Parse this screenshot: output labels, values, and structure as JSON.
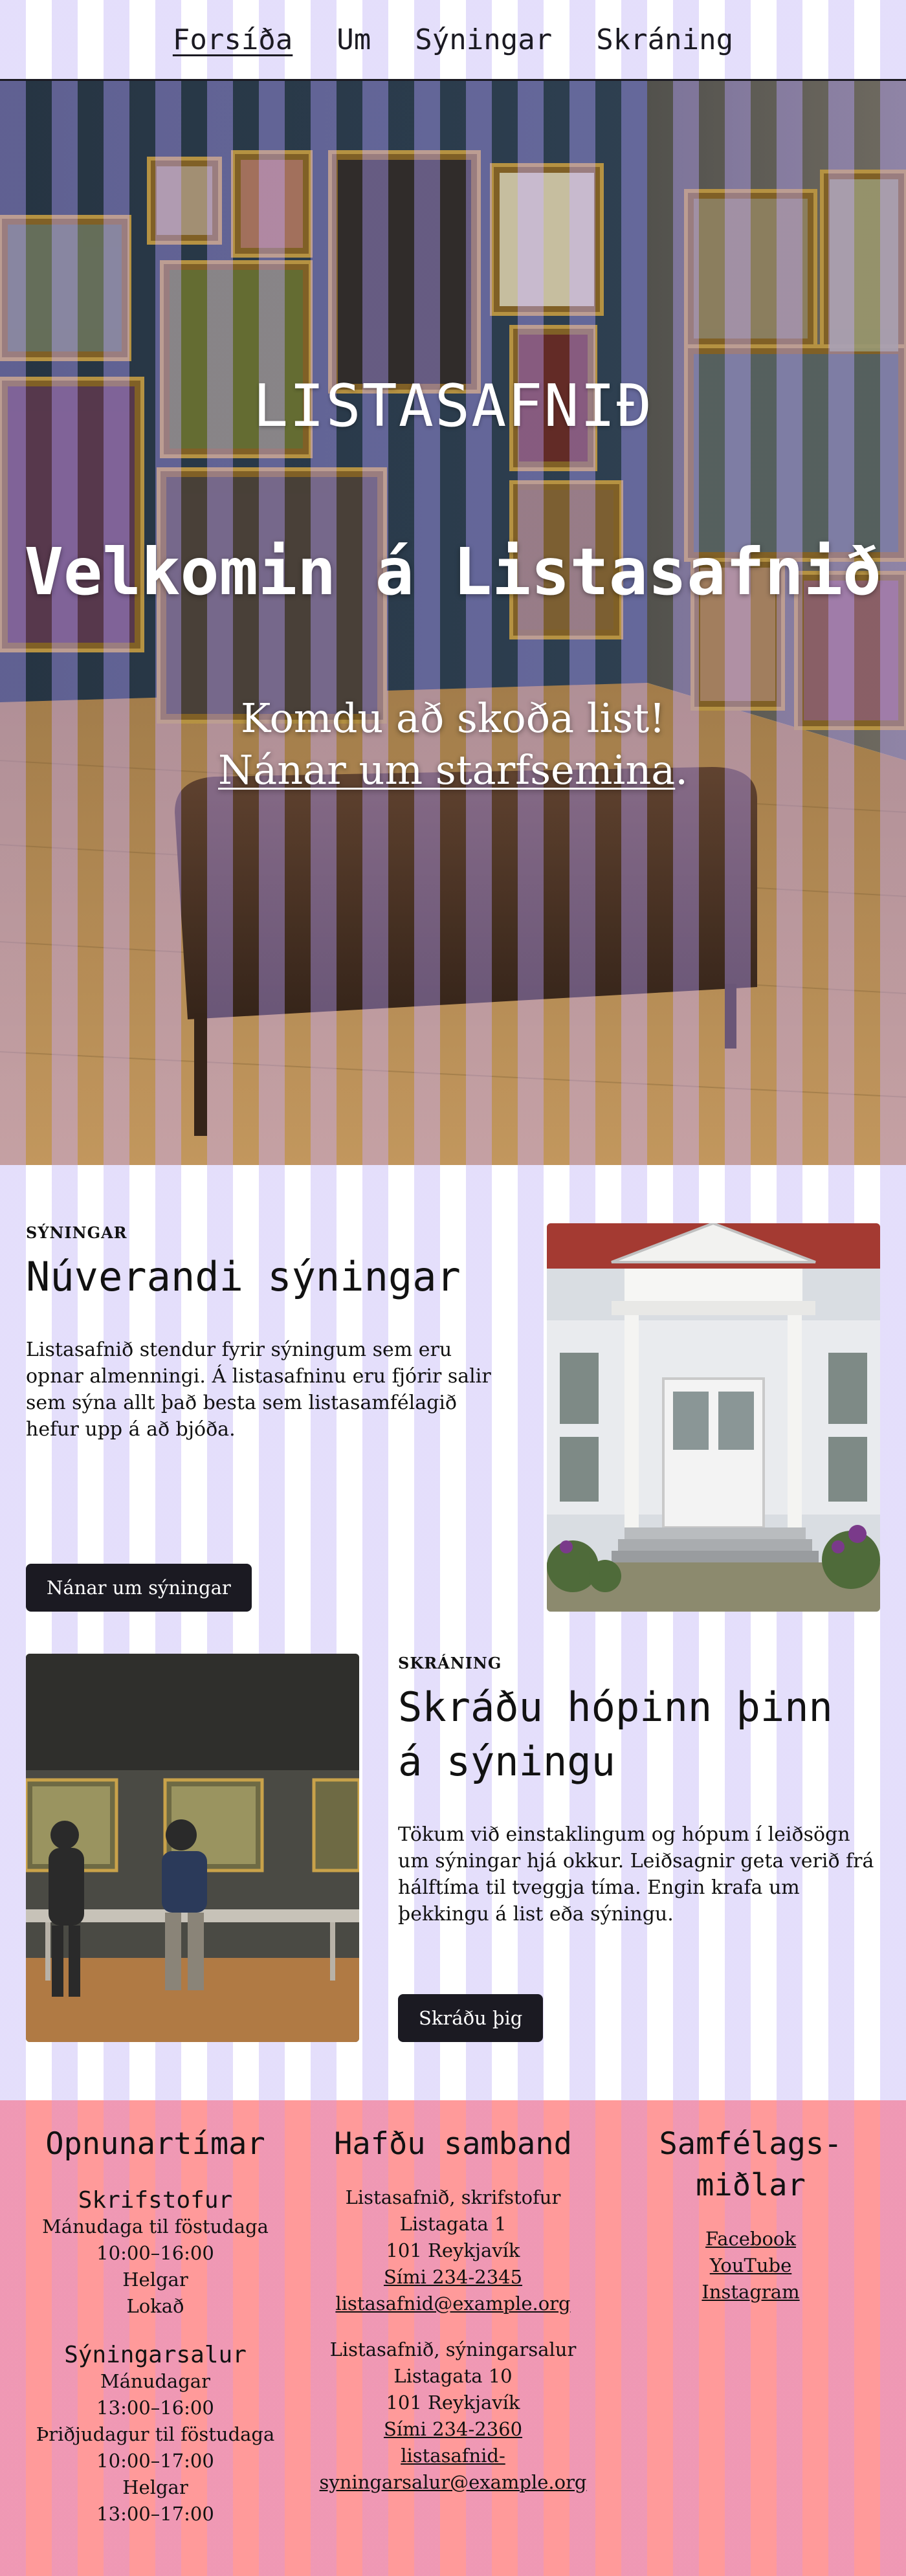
{
  "nav": {
    "items": [
      {
        "label": "Forsíða",
        "active": true
      },
      {
        "label": "Um",
        "active": false
      },
      {
        "label": "Sýningar",
        "active": false
      },
      {
        "label": "Skráning",
        "active": false
      }
    ]
  },
  "hero": {
    "kicker": "LISTASAFNIÐ",
    "title": "Velkomin á Listasafnið",
    "line1": "Komdu að skoða list!",
    "link": "Nánar um starfsemina",
    "link_suffix": "."
  },
  "exhibitions": {
    "eyebrow": "SÝNINGAR",
    "title": "Núverandi sýningar",
    "text": "Listasafnið stendur fyrir sýningum sem eru opnar almenningi. Á listasafninu eru fjórir salir sem sýna allt það besta sem listasamfélagið hefur upp á að bjóða.",
    "button": "Nánar um sýningar"
  },
  "registration": {
    "eyebrow": "SKRÁNING",
    "title": "Skráðu hópinn þinn á sýningu",
    "text": "Tökum við einstaklingum og hópum í leiðsögn um sýningar hjá okkur. Leiðsagnir geta verið frá hálftíma til tveggja tíma. Engin krafa um þekkingu á list eða sýningu.",
    "button": "Skráðu þig"
  },
  "footer": {
    "hours": {
      "title": "Opnunartímar",
      "office": {
        "title": "Skrifstofur",
        "lines": [
          "Mánudaga til föstudaga",
          "10:00–16:00",
          "Helgar",
          "Lokað"
        ]
      },
      "gallery": {
        "title": "Sýningarsalur",
        "lines": [
          "Mánudagar",
          "13:00–16:00",
          "Þriðjudagur til föstudaga",
          "10:00–17:00",
          "Helgar",
          "13:00–17:00"
        ]
      }
    },
    "contact": {
      "title": "Hafðu samband",
      "office": {
        "name": "Listasafnið, skrifstofur",
        "street": "Listagata 1",
        "city": "101 Reykjavík",
        "phone": "Sími 234-2345",
        "email": "listasafnid@example.org"
      },
      "gallery": {
        "name": "Listasafnið, sýningarsalur",
        "street": "Listagata 10",
        "city": "101 Reykjavík",
        "phone": "Sími 234-2360",
        "email_a": "listasafnid-",
        "email_b": "syningarsalur@example.org"
      }
    },
    "social": {
      "title_a": "Samfélags-",
      "title_b": "miðlar",
      "links": [
        "Facebook",
        "YouTube",
        "Instagram"
      ]
    }
  },
  "colors": {
    "stripe": "#cec4f8",
    "dark": "#1b1a22",
    "footer": "#ff9a9a"
  }
}
